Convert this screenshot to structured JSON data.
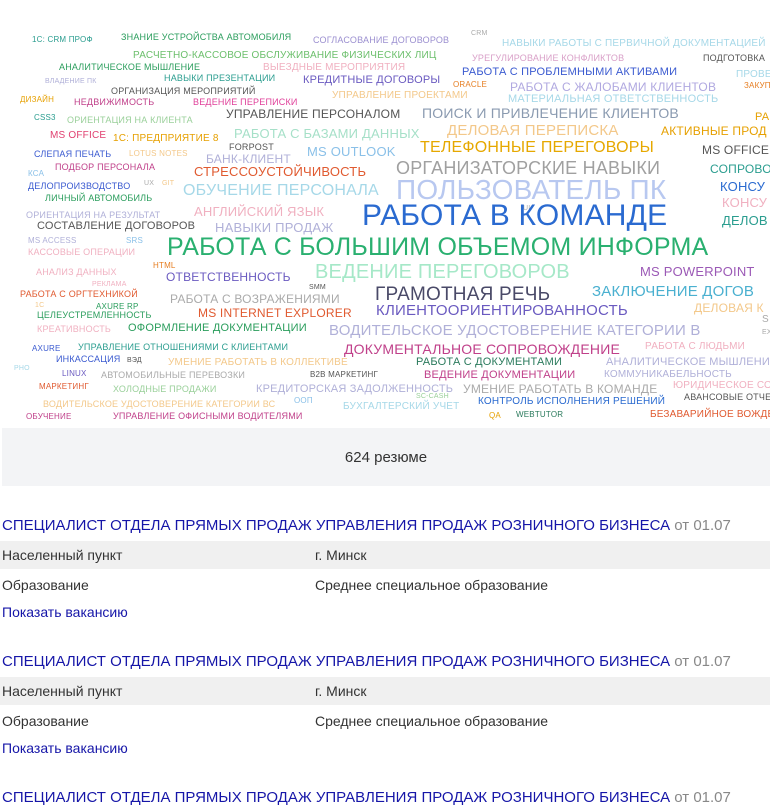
{
  "word_cloud": {
    "words": [
      {
        "t": "1С: CRM ПРОФ",
        "c": "#2a9d8f",
        "s": 8
      },
      {
        "t": "ЗНАНИЕ УСТРОЙСТВА АВТОМОБИЛЯ",
        "c": "#2a9d5c",
        "s": 9
      },
      {
        "t": "СОГЛАСОВАНИЕ ДОГОВОРОВ",
        "c": "#9b8fd0",
        "s": 9
      },
      {
        "t": "CRM",
        "c": "#aaa",
        "s": 7
      },
      {
        "t": "НАВЫКИ РАБОТЫ С ПЕРВИЧНОЙ ДОКУМЕНТАЦИЕЙ",
        "c": "#a6d8e8",
        "s": 10
      },
      {
        "t": "РАСЧЕТНО-КАССОВОЕ ОБСЛУЖИВАНИЕ ФИЗИЧЕСКИХ ЛИЦ",
        "c": "#6cbf6c",
        "s": 10
      },
      {
        "t": "УРЕГУЛИРОВАНИЕ КОНФЛИКТОВ",
        "c": "#d9a0c8",
        "s": 9
      },
      {
        "t": "ПОДГОТОВКА",
        "c": "#555",
        "s": 9
      },
      {
        "t": "АНАЛИТИЧЕСКОЕ МЫШЛЕНИЕ",
        "c": "#2a9d5c",
        "s": 9
      },
      {
        "t": "ВЫЕЗДНЫЕ МЕРОПРИЯТИЯ",
        "c": "#f0b0c0",
        "s": 10
      },
      {
        "t": "РАБОТА С ПРОБЛЕМНЫМИ АКТИВАМИ",
        "c": "#3a5ad0",
        "s": 11
      },
      {
        "t": "ПРОВЕ",
        "c": "#a6d8e8",
        "s": 10
      },
      {
        "t": "ВЛАДЕНИЕ ПК",
        "c": "#b0b0d8",
        "s": 7
      },
      {
        "t": "НАВЫКИ ПРЕЗЕНТАЦИИ",
        "c": "#2a9d8f",
        "s": 9
      },
      {
        "t": "КРЕДИТНЫЕ ДОГОВОРЫ",
        "c": "#6a5ac0",
        "s": 11
      },
      {
        "t": "ORACLE",
        "c": "#e67e22",
        "s": 8
      },
      {
        "t": "РАБОТА С ЖАЛОБАМИ КЛИЕНТОВ",
        "c": "#b0a8e0",
        "s": 12
      },
      {
        "t": "ЗАКУП",
        "c": "#e67e22",
        "s": 8
      },
      {
        "t": "ОРГАНИЗАЦИЯ МЕРОПРИЯТИЙ",
        "c": "#555",
        "s": 9
      },
      {
        "t": "ДИЗАЙН",
        "c": "#e6a000",
        "s": 8
      },
      {
        "t": "НЕДВИЖИМОСТЬ",
        "c": "#c0408a",
        "s": 9
      },
      {
        "t": "ВЕДЕНИЕ ПЕРЕПИСКИ",
        "c": "#e0409a",
        "s": 9
      },
      {
        "t": "УПРАВЛЕНИЕ ПРОЕКТАМИ",
        "c": "#f3c88a",
        "s": 10
      },
      {
        "t": "МАТЕРИАЛЬНАЯ ОТВЕТСТВЕННОСТЬ",
        "c": "#a6d8e8",
        "s": 11
      },
      {
        "t": "УПРАВЛЕНИЕ ПЕРСОНАЛОМ",
        "c": "#555",
        "s": 12
      },
      {
        "t": "ПОИСК И ПРИВЛЕЧЕНИЕ КЛИЕНТОВ",
        "c": "#8a9ab0",
        "s": 14
      },
      {
        "t": "CSS3",
        "c": "#2a9d8f",
        "s": 8
      },
      {
        "t": "ОРИЕНТАЦИЯ НА КЛИЕНТА",
        "c": "#9ad09a",
        "s": 9
      },
      {
        "t": "PA",
        "c": "#e6a000",
        "s": 11
      },
      {
        "t": "MS OFFICE",
        "c": "#e04070",
        "s": 10
      },
      {
        "t": "1С: ПРЕДПРИЯТИЕ 8",
        "c": "#e6a000",
        "s": 10
      },
      {
        "t": "РАБОТА С БАЗАМИ ДАННЫХ",
        "c": "#a6e0c8",
        "s": 13
      },
      {
        "t": "ДЕЛОВАЯ ПЕРЕПИСКА",
        "c": "#f3c88a",
        "s": 15
      },
      {
        "t": "АКТИВНЫЕ ПРОД",
        "c": "#e6a000",
        "s": 12
      },
      {
        "t": "СЛЕПАЯ ПЕЧАТЬ",
        "c": "#3a5ad0",
        "s": 9
      },
      {
        "t": "LOTUS NOTES",
        "c": "#f3c88a",
        "s": 8
      },
      {
        "t": "FORPOST",
        "c": "#555",
        "s": 9
      },
      {
        "t": "ТЕЛЕФОННЫЕ ПЕРЕГОВОРЫ",
        "c": "#e6a800",
        "s": 16
      },
      {
        "t": "MS OFFICE",
        "c": "#555",
        "s": 12
      },
      {
        "t": "БАНК-КЛИЕНТ",
        "c": "#b0b0d8",
        "s": 12
      },
      {
        "t": "MS OUTLOOK",
        "c": "#8ac0e8",
        "s": 13
      },
      {
        "t": "ОРГАНИЗАТОРСКИЕ НАВЫКИ",
        "c": "#a0a0a0",
        "s": 18
      },
      {
        "t": "СОПРОВО",
        "c": "#2a9d8f",
        "s": 12
      },
      {
        "t": "КСА",
        "c": "#8ac0e8",
        "s": 8
      },
      {
        "t": "ПОДБОР ПЕРСОНАЛА",
        "c": "#c0408a",
        "s": 9
      },
      {
        "t": "СТРЕССОУСТОЙЧИВОСТЬ",
        "c": "#e05a30",
        "s": 13
      },
      {
        "t": "ДЕЛОПРОИЗВОДСТВО",
        "c": "#3a5ad0",
        "s": 9
      },
      {
        "t": "UX",
        "c": "#aaa",
        "s": 7
      },
      {
        "t": "GIT",
        "c": "#f3c88a",
        "s": 7
      },
      {
        "t": "ПОЛЬЗОВАТЕЛЬ ПК",
        "c": "#b8c8f0",
        "s": 28
      },
      {
        "t": "КОНСУ",
        "c": "#2a6ad0",
        "s": 13
      },
      {
        "t": "ОБУЧЕНИЕ ПЕРСОНАЛА",
        "c": "#a6d8e8",
        "s": 16
      },
      {
        "t": "ЛИЧНЫЙ АВТОМОБИЛЬ",
        "c": "#2a9d5c",
        "s": 9
      },
      {
        "t": "КОНСУ",
        "c": "#f0b0c0",
        "s": 13
      },
      {
        "t": "АНГЛИЙСКИЙ ЯЗЫК",
        "c": "#f0b0c0",
        "s": 13
      },
      {
        "t": "UI",
        "c": "#aaa",
        "s": 7
      },
      {
        "t": "ОРИЕНТАЦИЯ НА РЕЗУЛЬТАТ",
        "c": "#b0b0d8",
        "s": 9
      },
      {
        "t": "РАБОТА В КОМАНДЕ",
        "c": "#2a6ad0",
        "s": 30
      },
      {
        "t": "ДЕЛОВ",
        "c": "#2a9d8f",
        "s": 13
      },
      {
        "t": "СОСТАВЛЕНИЕ ДОГОВОРОВ",
        "c": "#555",
        "s": 11
      },
      {
        "t": "НАВЫКИ ПРОДАЖ",
        "c": "#b0b0d8",
        "s": 13
      },
      {
        "t": "MS ACCESS",
        "c": "#b0b0d8",
        "s": 8
      },
      {
        "t": "SRS",
        "c": "#8ac0e8",
        "s": 8
      },
      {
        "t": "РАБОТА С БОЛЬШИМ ОБЪЕМОМ ИНФОРМА",
        "c": "#2ab070",
        "s": 25
      },
      {
        "t": "КАССОВЫЕ ОПЕРАЦИИ",
        "c": "#f0b0c0",
        "s": 9
      },
      {
        "t": "ВЕДЕНИЕ ПЕРЕГОВОРОВ",
        "c": "#a6e8c8",
        "s": 20
      },
      {
        "t": "HTML",
        "c": "#e67e22",
        "s": 8
      },
      {
        "t": "АНАЛИЗ ДАННЫХ",
        "c": "#f0b0c0",
        "s": 9
      },
      {
        "t": "ОТВЕТСТВЕННОСТЬ",
        "c": "#6a5ac0",
        "s": 12
      },
      {
        "t": "MS POWERPOINT",
        "c": "#9b59b6",
        "s": 13
      },
      {
        "t": "РЕКЛАМА",
        "c": "#f0b0c0",
        "s": 7
      },
      {
        "t": "SMM",
        "c": "#555",
        "s": 7
      },
      {
        "t": "ГРАМОТНАЯ РЕЧЬ",
        "c": "#4a4a68",
        "s": 19
      },
      {
        "t": "ЗАКЛЮЧЕНИЕ ДОГОВ",
        "c": "#4ab0d0",
        "s": 15
      },
      {
        "t": "РАБОТА С ОРГТЕХНИКОЙ",
        "c": "#e05a30",
        "s": 9
      },
      {
        "t": "РАБОТА С ВОЗРАЖЕНИЯМИ",
        "c": "#aaa",
        "s": 12
      },
      {
        "t": "ДЕЛОВАЯ К",
        "c": "#f3c88a",
        "s": 12
      },
      {
        "t": "1С",
        "c": "#f3c88a",
        "s": 7
      },
      {
        "t": "AXURE RP",
        "c": "#2a9d5c",
        "s": 8
      },
      {
        "t": "ЦЕЛЕУСТРЕМЛЕННОСТЬ",
        "c": "#2a9d5c",
        "s": 9
      },
      {
        "t": "MS INTERNET EXPLORER",
        "c": "#e05a30",
        "s": 12
      },
      {
        "t": "КЛИЕНТООРИЕНТИРОВАННОСТЬ",
        "c": "#6a5ac0",
        "s": 15
      },
      {
        "t": "S",
        "c": "#aaa",
        "s": 10
      },
      {
        "t": "КРЕАТИВНОСТЬ",
        "c": "#f0b0c0",
        "s": 9
      },
      {
        "t": "ОФОРМЛЕНИЕ ДОКУМЕНТАЦИИ",
        "c": "#2a9d5c",
        "s": 11
      },
      {
        "t": "ВОДИТЕЛЬСКОЕ УДОСТОВЕРЕНИЕ КАТЕГОРИИ В",
        "c": "#b0b0d8",
        "s": 15
      },
      {
        "t": "EXCEL",
        "c": "#aaa",
        "s": 7
      },
      {
        "t": "AXURE",
        "c": "#3a5ad0",
        "s": 8
      },
      {
        "t": "УПРАВЛЕНИЕ ОТНОШЕНИЯМИ С КЛИЕНТАМИ",
        "c": "#2a9d8f",
        "s": 9
      },
      {
        "t": "ДОКУМЕНТАЛЬНОЕ СОПРОВОЖДЕНИЕ",
        "c": "#c0408a",
        "s": 14
      },
      {
        "t": "РАБОТА С ЛЮДЬМИ",
        "c": "#f0b0c0",
        "s": 10
      },
      {
        "t": "ИНКАССАЦИЯ",
        "c": "#3a5ad0",
        "s": 9
      },
      {
        "t": "ВЭД",
        "c": "#555",
        "s": 7
      },
      {
        "t": "УМЕНИЕ РАБОТАТЬ В КОЛЛЕКТИВЕ",
        "c": "#f3c88a",
        "s": 10
      },
      {
        "t": "РАБОТА С ДОКУМЕНТАМИ",
        "c": "#2a7a5c",
        "s": 11
      },
      {
        "t": "АНАЛИТИЧЕСКОЕ МЫШЛЕНИЕ",
        "c": "#b0b0d8",
        "s": 11
      },
      {
        "t": "PHO",
        "c": "#a6d8e8",
        "s": 7
      },
      {
        "t": "LINUX",
        "c": "#6a5ac0",
        "s": 8
      },
      {
        "t": "АВТОМОБИЛЬНЫЕ ПЕРЕВОЗКИ",
        "c": "#aaa",
        "s": 9
      },
      {
        "t": "B2B МАРКЕТИНГ",
        "c": "#555",
        "s": 8
      },
      {
        "t": "ВЕДЕНИЕ ДОКУМЕНТАЦИИ",
        "c": "#c0408a",
        "s": 11
      },
      {
        "t": "КОММУНИКАБЕЛЬНОСТЬ",
        "c": "#b0b0d8",
        "s": 10
      },
      {
        "t": "МАРКЕТИНГ",
        "c": "#e05a30",
        "s": 8
      },
      {
        "t": "ХОЛОДНЫЕ ПРОДАЖИ",
        "c": "#9ad09a",
        "s": 9
      },
      {
        "t": "КРЕДИТОРСКАЯ ЗАДОЛЖЕННОСТЬ",
        "c": "#b0b0d8",
        "s": 11
      },
      {
        "t": "УМЕНИЕ РАБОТАТЬ В КОМАНДЕ",
        "c": "#aaa",
        "s": 12
      },
      {
        "t": "ЮРИДИЧЕСКОЕ СО",
        "c": "#f0b0c0",
        "s": 10
      },
      {
        "t": "АВАНСОВЫЕ ОТЧЕ",
        "c": "#555",
        "s": 9
      },
      {
        "t": "ВОДИТЕЛЬСКОЕ УДОСТОВЕРЕНИЕ КАТЕГОРИИ ВС",
        "c": "#f3c88a",
        "s": 9
      },
      {
        "t": "OOП",
        "c": "#8ac0e8",
        "s": 8
      },
      {
        "t": "БУХГАЛТЕРСКИЙ УЧЕТ",
        "c": "#a6d8e8",
        "s": 10
      },
      {
        "t": "SC-CASH",
        "c": "#9ad09a",
        "s": 7
      },
      {
        "t": "КОНТРОЛЬ ИСПОЛНЕНИЯ РЕШЕНИЙ",
        "c": "#2a6ad0",
        "s": 10
      },
      {
        "t": "ОБУЧЕНИЕ",
        "c": "#c0408a",
        "s": 8
      },
      {
        "t": "УПРАВЛЕНИЕ ОФИСНЫМИ ВОДИТЕЛЯМИ",
        "c": "#c0408a",
        "s": 9
      },
      {
        "t": "QA",
        "c": "#e6a000",
        "s": 8
      },
      {
        "t": "WEBTUTOR",
        "c": "#2a7a5c",
        "s": 8
      },
      {
        "t": "БЕЗАВАРИЙНОЕ ВОЖДЕН",
        "c": "#e05a30",
        "s": 10
      }
    ]
  },
  "resume_count": "624 резюме",
  "vacancies": [
    {
      "title": "СПЕЦИАЛИСТ ОТДЕЛА ПРЯМЫХ ПРОДАЖ УПРАВЛЕНИЯ ПРОДАЖ РОЗНИЧНОГО БИЗНЕСА",
      "date": "от 01.07",
      "location_label": "Населенный пункт",
      "location_value": "г. Минск",
      "education_label": "Образование",
      "education_value": "Среднее специальное образование",
      "link": "Показать вакансию"
    },
    {
      "title": "СПЕЦИАЛИСТ ОТДЕЛА ПРЯМЫХ ПРОДАЖ УПРАВЛЕНИЯ ПРОДАЖ РОЗНИЧНОГО БИЗНЕСА",
      "date": "от 01.07",
      "location_label": "Населенный пункт",
      "location_value": "г. Минск",
      "education_label": "Образование",
      "education_value": "Среднее специальное образование",
      "link": "Показать вакансию"
    },
    {
      "title": "СПЕЦИАЛИСТ ОТДЕЛА ПРЯМЫХ ПРОДАЖ УПРАВЛЕНИЯ ПРОДАЖ РОЗНИЧНОГО БИЗНЕСА",
      "date": "от 01.07"
    }
  ]
}
